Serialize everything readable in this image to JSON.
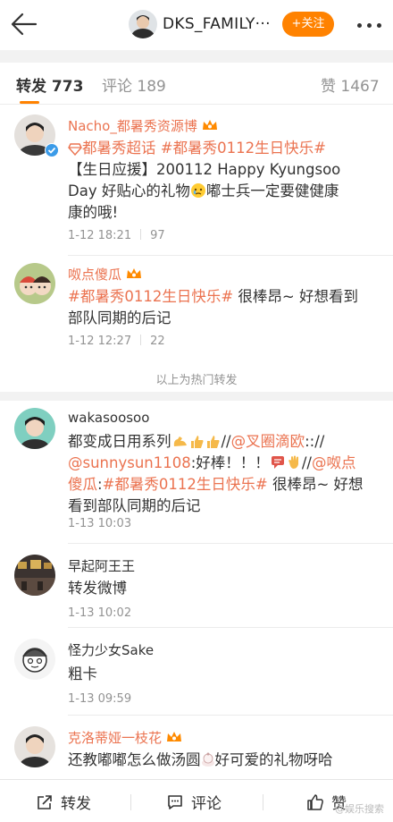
{
  "header": {
    "title": "DKS_FAMILY···",
    "follow_label": "+关注"
  },
  "tabs": [
    {
      "label": "转发 773"
    },
    {
      "label": "评论 189"
    },
    {
      "label": "赞 1467"
    }
  ],
  "hot_label": "以上为热门转发",
  "reposts": [
    {
      "name": "Nacho_都暑秀资源博",
      "line1_tag1": "都暑秀超话",
      "line1_tag2": "#都暑秀0112生日快乐#",
      "line2": "【生日应援】200112 Happy Kyungsoo",
      "line3a": "Day 好贴心的礼物",
      "line3b": "嘟士兵一定要健健康",
      "line4": "康的哦!",
      "time": "1-12 18:21",
      "likes": "97"
    },
    {
      "name": "呶点傻瓜",
      "tag": "#都暑秀0112生日快乐#",
      "text_a": " 很棒昂~ 好想看到",
      "text_b": "部队同期的后记",
      "time": "1-12 12:27",
      "likes": "22"
    },
    {
      "name": "wakasoosoo",
      "l1a": "都变成日用系列",
      "l1b": "//",
      "l1c": "@叉圈滴欧",
      "l1d": ":://",
      "l2a": "@sunnysun1108",
      "l2b": ":好棒！！！",
      "l2c": "//",
      "l2d": "@呶点",
      "l3a": "傻瓜",
      "l3b": ":",
      "l3c": "#都暑秀0112生日快乐#",
      "l3d": " 很棒昂~ 好想",
      "l4": "看到部队同期的后记",
      "time": "1-13 10:03"
    },
    {
      "name": "早起阿王王",
      "text": "转发微博",
      "time": "1-13 10:02"
    },
    {
      "name": "怪力少女Sake",
      "text": "粗卡",
      "time": "1-13 09:59"
    },
    {
      "name": "克洛蒂娅一枝花",
      "text_a": "还教嘟嘟怎么做汤圆",
      "text_b": "好可爱的礼物呀哈"
    }
  ],
  "bottom": {
    "repost": "转发",
    "comment": "评论",
    "like": "赞"
  },
  "watermark": "@娱乐搜索"
}
